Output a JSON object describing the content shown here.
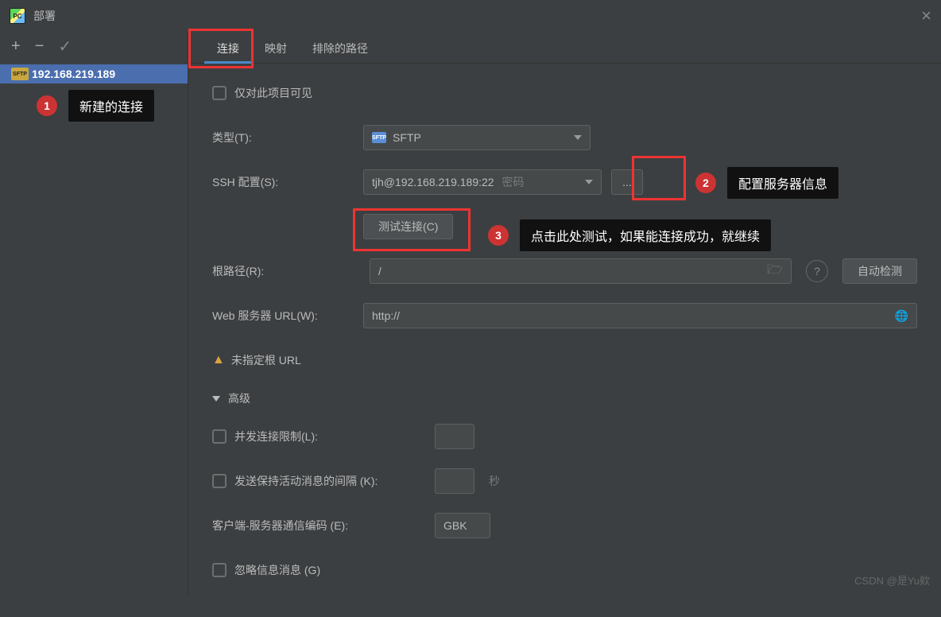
{
  "title": "部署",
  "close": "×",
  "toolbar": {
    "add": "+",
    "remove": "−",
    "check": "✓"
  },
  "server": {
    "name": "192.168.219.189",
    "badge": "SFTP"
  },
  "tabs": {
    "connection": "连接",
    "mapping": "映射",
    "excluded": "排除的路径"
  },
  "form": {
    "visible_only": "仅对此项目可见",
    "type_label": "类型(T):",
    "type_value": "SFTP",
    "ssh_label": "SSH 配置(S):",
    "ssh_value": "tjh@192.168.219.189:22",
    "ssh_pw": "密码",
    "ellipsis": "...",
    "test_btn": "测试连接(C)",
    "root_label": "根路径(R):",
    "root_value": "/",
    "autodetect": "自动检测",
    "web_label": "Web 服务器 URL(W):",
    "web_value": "http://",
    "warn": "未指定根 URL",
    "advanced": "高级",
    "conn_limit": "并发连接限制(L):",
    "keepalive": "发送保持活动消息的间隔 (K):",
    "seconds": "秒",
    "encoding_label": "客户端-服务器通信编码 (E):",
    "encoding_value": "GBK",
    "ignore_info": "忽略信息消息 (G)"
  },
  "callouts": {
    "c1": {
      "num": "1",
      "text": "新建的连接"
    },
    "c2": {
      "num": "2",
      "text": "配置服务器信息"
    },
    "c3": {
      "num": "3",
      "text": "点击此处测试，如果能连接成功，就继续"
    }
  },
  "watermark": "CSDN @是Yu欸"
}
